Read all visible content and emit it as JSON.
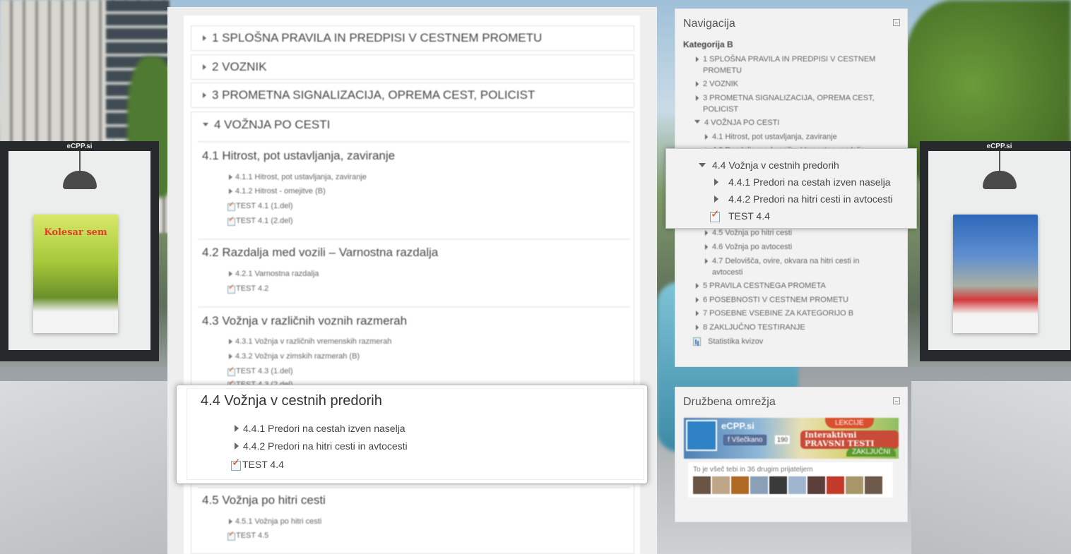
{
  "sections": [
    {
      "label": "1 SPLOŠNA PRAVILA IN PREDPISI V CESTNEM PROMETU"
    },
    {
      "label": "2 VOZNIK"
    },
    {
      "label": "3 PROMETNA SIGNALIZACIJA, OPREMA CEST, POLICIST"
    },
    {
      "label": "4 VOŽNJA PO CESTI"
    }
  ],
  "subsections": {
    "s41": {
      "title": "4.1 Hitrost, pot ustavljanja, zaviranje",
      "lessons": [
        "4.1.1 Hitrost, pot ustavljanja, zaviranje",
        "4.1.2 Hitrost - omejitve (B)"
      ],
      "quizzes": [
        "TEST 4.1 (1.del)",
        "TEST 4.1 (2.del)"
      ]
    },
    "s42": {
      "title": "4.2 Razdalja med vozili – Varnostna razdalja",
      "lessons": [
        "4.2.1 Varnostna razdalja"
      ],
      "quizzes": [
        "TEST 4.2"
      ]
    },
    "s43": {
      "title": "4.3 Vožnja v različnih voznih razmerah",
      "lessons": [
        "4.3.1 Vožnja v različnih vremenskih razmerah",
        "4.3.2 Vožnja v zimskih razmerah (B)"
      ],
      "quizzes": [
        "TEST 4.3 (1.del)",
        "TEST 4.3 (2.del)"
      ]
    },
    "s44": {
      "title": "4.4 Vožnja v cestnih predorih",
      "lessons": [
        "4.4.1 Predori na cestah izven naselja",
        "4.4.2 Predori na hitri cesti in avtocesti"
      ],
      "quizzes": [
        "TEST 4.4"
      ]
    },
    "s45": {
      "title": "4.5 Vožnja po hitri cesti",
      "lessons": [
        "4.5.1 Vožnja po hitri cesti"
      ],
      "quizzes": [
        "TEST 4.5"
      ]
    }
  },
  "navigation": {
    "title": "Navigacija",
    "root": "Kategorija B",
    "items": [
      "1 SPLOŠNA PRAVILA IN PREDPISI V CESTNEM PROMETU",
      "2 VOZNIK",
      "3 PROMETNA SIGNALIZACIJA, OPREMA CEST, POLICIST",
      "4 VOŽNJA PO CESTI",
      "4.1 Hitrost, pot ustavljanja, zaviranje",
      "4.2 Razdalja med vozili – Varnostna razdalja",
      "4.5 Vožnja po hitri cesti",
      "4.6 Vožnja po avtocesti",
      "4.7 Delovišča, ovire, okvara na hitri cesti in avtocesti",
      "5 PRAVILA CESTNEGA PROMETA",
      "6 POSEBNOSTI V CESTNEM PROMETU",
      "7 POSEBNE VSEBINE ZA KATEGORIJO B",
      "8 ZAKLJUČNO TESTIRANJE",
      "Statistika kvizov"
    ],
    "focus": {
      "title": "4.4 Vožnja v cestnih predorih",
      "items": [
        "4.4.1 Predori na cestah izven naselja",
        "4.4.2 Predori na hitri cesti in avtocesti",
        "TEST 4.4"
      ]
    }
  },
  "social": {
    "title": "Družbena omrežja",
    "page_name": "eCPP.si",
    "like_label": "Všečkano",
    "like_count": "190",
    "promo_text": "Interaktivni PRAVSNI TESTI",
    "promo_lekcije": "LEKCIJE",
    "promo_zakljucni": "ZAKLJUČNI",
    "friends_text": "To je všeč tebi in 36 drugim prijateljem",
    "face_colors": [
      "#6a5444",
      "#c0a688",
      "#b06a24",
      "#8aa0b8",
      "#3a3a3a",
      "#9fb5d0",
      "#5a3f3a",
      "#c23a2a",
      "#a8956a",
      "#6d5a4a"
    ]
  },
  "kiosks": {
    "left_label": "eCPP.si",
    "right_label": "eCPP.si",
    "left_poster_title": "Kolesar sem"
  },
  "colors": {
    "panel_bg": "#eeeeee",
    "block_bg": "#f2f2f2",
    "quiz_check": "#e2461b",
    "text": "#444444"
  }
}
